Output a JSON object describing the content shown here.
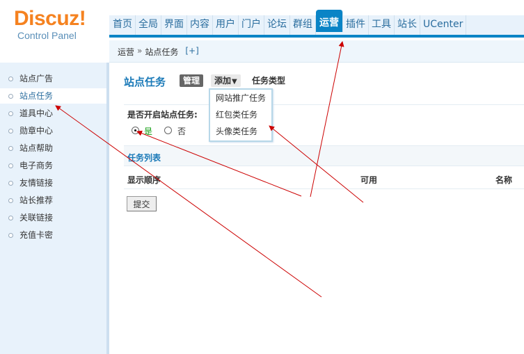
{
  "logo": {
    "brand": "Discuz!",
    "subtitle": "Control Panel"
  },
  "nav": {
    "items": [
      "首页",
      "全局",
      "界面",
      "内容",
      "用户",
      "门户",
      "论坛",
      "群组",
      "运营",
      "插件",
      "工具",
      "站长",
      "UCenter"
    ],
    "active": "运营"
  },
  "breadcrumb": {
    "section": "运营",
    "separator": "»",
    "page": "站点任务",
    "add": "[+]"
  },
  "sidebar": {
    "items": [
      "站点广告",
      "站点任务",
      "道具中心",
      "勋章中心",
      "站点帮助",
      "电子商务",
      "友情链接",
      "站长推荐",
      "关联链接",
      "充值卡密"
    ],
    "active": "站点任务"
  },
  "main": {
    "title": "站点任务",
    "tabs": {
      "manage": "管理",
      "add": "添加",
      "add_arrow": "▼",
      "type": "任务类型"
    },
    "dropdown": [
      "网站推广任务",
      "红包类任务",
      "头像类任务"
    ],
    "enable_label": "是否开启站点任务:",
    "radio": {
      "yes": "是",
      "no": "否",
      "selected": "是"
    },
    "list_title": "任务列表",
    "columns": {
      "order": "显示顺序",
      "available": "可用",
      "name": "名称"
    },
    "submit": "提交"
  },
  "colors": {
    "accent": "#0a84c6",
    "logo": "#f58220",
    "link": "#1b7ab8",
    "annotation": "#cc0000"
  }
}
